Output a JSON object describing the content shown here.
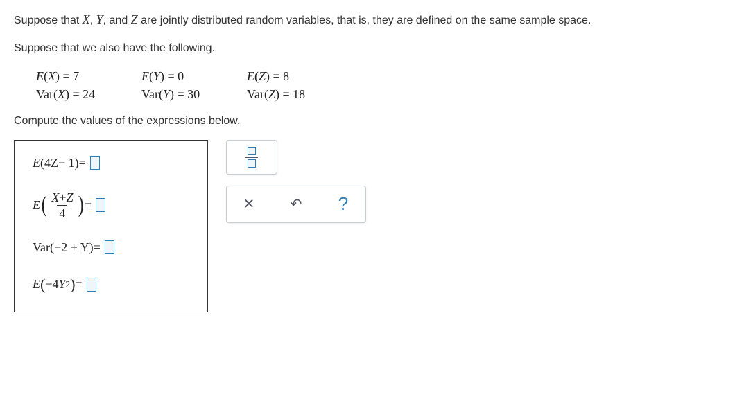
{
  "intro": {
    "part1": "Suppose that ",
    "varX": "X",
    "sep1": ", ",
    "varY": "Y",
    "sep2": ", and ",
    "varZ": "Z",
    "part2": " are jointly distributed random variables, that is, they are defined on the same sample space."
  },
  "intro2": "Suppose that we also have the following.",
  "given": {
    "ex_label": "E",
    "var_label": "Var",
    "ex_x": "7",
    "ex_y": "0",
    "ex_z": "8",
    "var_x": "24",
    "var_y": "30",
    "var_z": "18"
  },
  "compute": "Compute the values of the expressions below.",
  "answers": {
    "expr1_inside": "4Z",
    "expr1_tail": "− 1",
    "expr2_num1": "X",
    "expr2_num2": "Z",
    "expr2_den": "4",
    "expr3_inner": "−2 + Y",
    "expr4_coef": "−4",
    "expr4_var": "Y",
    "expr4_exp": "2",
    "equals": " = "
  },
  "tools": {
    "clear": "✕",
    "undo": "↶",
    "help": "?"
  },
  "chart_data": {
    "type": "table",
    "title": "Given expectations and variances",
    "columns": [
      "X",
      "Y",
      "Z"
    ],
    "rows": [
      {
        "label": "E",
        "values": [
          7,
          0,
          8
        ]
      },
      {
        "label": "Var",
        "values": [
          24,
          30,
          18
        ]
      }
    ]
  }
}
